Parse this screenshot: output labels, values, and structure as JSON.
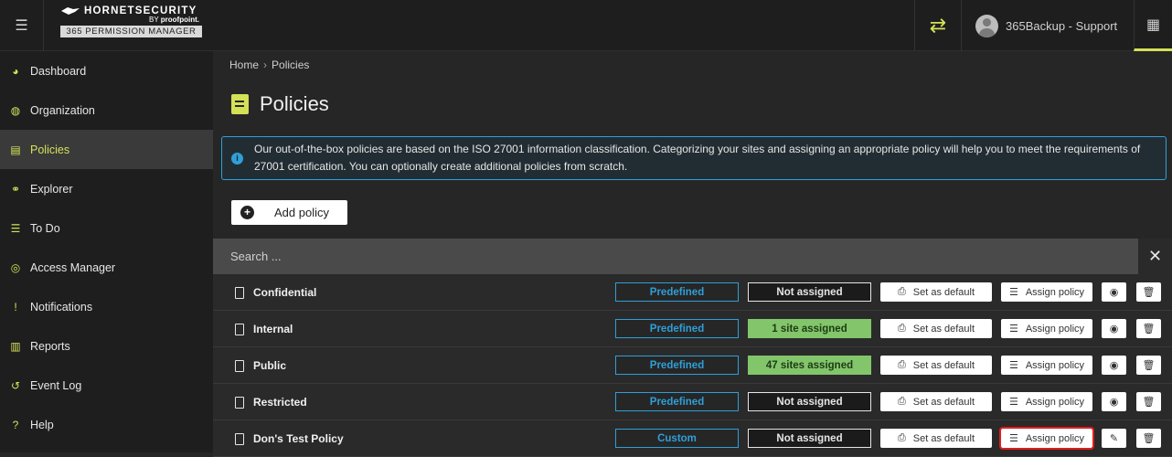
{
  "header": {
    "brand": "HORNETSECURITY",
    "by": "BY",
    "partner": "proofpoint.",
    "product": "365 PERMISSION MANAGER",
    "user": "365Backup - Support"
  },
  "sidebar": {
    "items": [
      {
        "label": "Dashboard",
        "icon": "dashboard-icon",
        "glyph": "◕"
      },
      {
        "label": "Organization",
        "icon": "globe-icon",
        "glyph": "◍"
      },
      {
        "label": "Policies",
        "icon": "policy-icon",
        "glyph": "▤"
      },
      {
        "label": "Explorer",
        "icon": "binoculars-icon",
        "glyph": "⚭"
      },
      {
        "label": "To Do",
        "icon": "todo-list-icon",
        "glyph": "☰"
      },
      {
        "label": "Access Manager",
        "icon": "target-icon",
        "glyph": "◎"
      },
      {
        "label": "Notifications",
        "icon": "alert-icon",
        "glyph": "!"
      },
      {
        "label": "Reports",
        "icon": "chart-icon",
        "glyph": "▥"
      },
      {
        "label": "Event Log",
        "icon": "history-icon",
        "glyph": "↺"
      },
      {
        "label": "Help",
        "icon": "help-icon",
        "glyph": "?"
      }
    ],
    "active_index": 2
  },
  "breadcrumb": {
    "home": "Home",
    "current": "Policies"
  },
  "page": {
    "title": "Policies"
  },
  "info": {
    "text": "Our out-of-the-box policies are based on the ISO 27001 information classification. Categorizing your sites and assigning an appropriate policy will help you to meet the requirements of 27001 certification. You can optionally create additional policies from scratch."
  },
  "actions": {
    "add_policy": "Add policy"
  },
  "search": {
    "placeholder": "Search ..."
  },
  "row_buttons": {
    "set_default": "Set as default",
    "assign_policy": "Assign policy"
  },
  "policies": [
    {
      "name": "Confidential",
      "type": "Predefined",
      "assignment": "Not assigned",
      "assigned": false,
      "editable": false
    },
    {
      "name": "Internal",
      "type": "Predefined",
      "assignment": "1 site assigned",
      "assigned": true,
      "editable": false
    },
    {
      "name": "Public",
      "type": "Predefined",
      "assignment": "47 sites assigned",
      "assigned": true,
      "editable": false
    },
    {
      "name": "Restricted",
      "type": "Predefined",
      "assignment": "Not assigned",
      "assigned": false,
      "editable": false
    },
    {
      "name": "Don's Test Policy",
      "type": "Custom",
      "assignment": "Not assigned",
      "assigned": false,
      "editable": true
    }
  ],
  "colors": {
    "accent": "#d4e157",
    "info_border": "#2f9fd8",
    "assigned_green": "#82c56b",
    "highlight_red": "#e21d1d"
  }
}
